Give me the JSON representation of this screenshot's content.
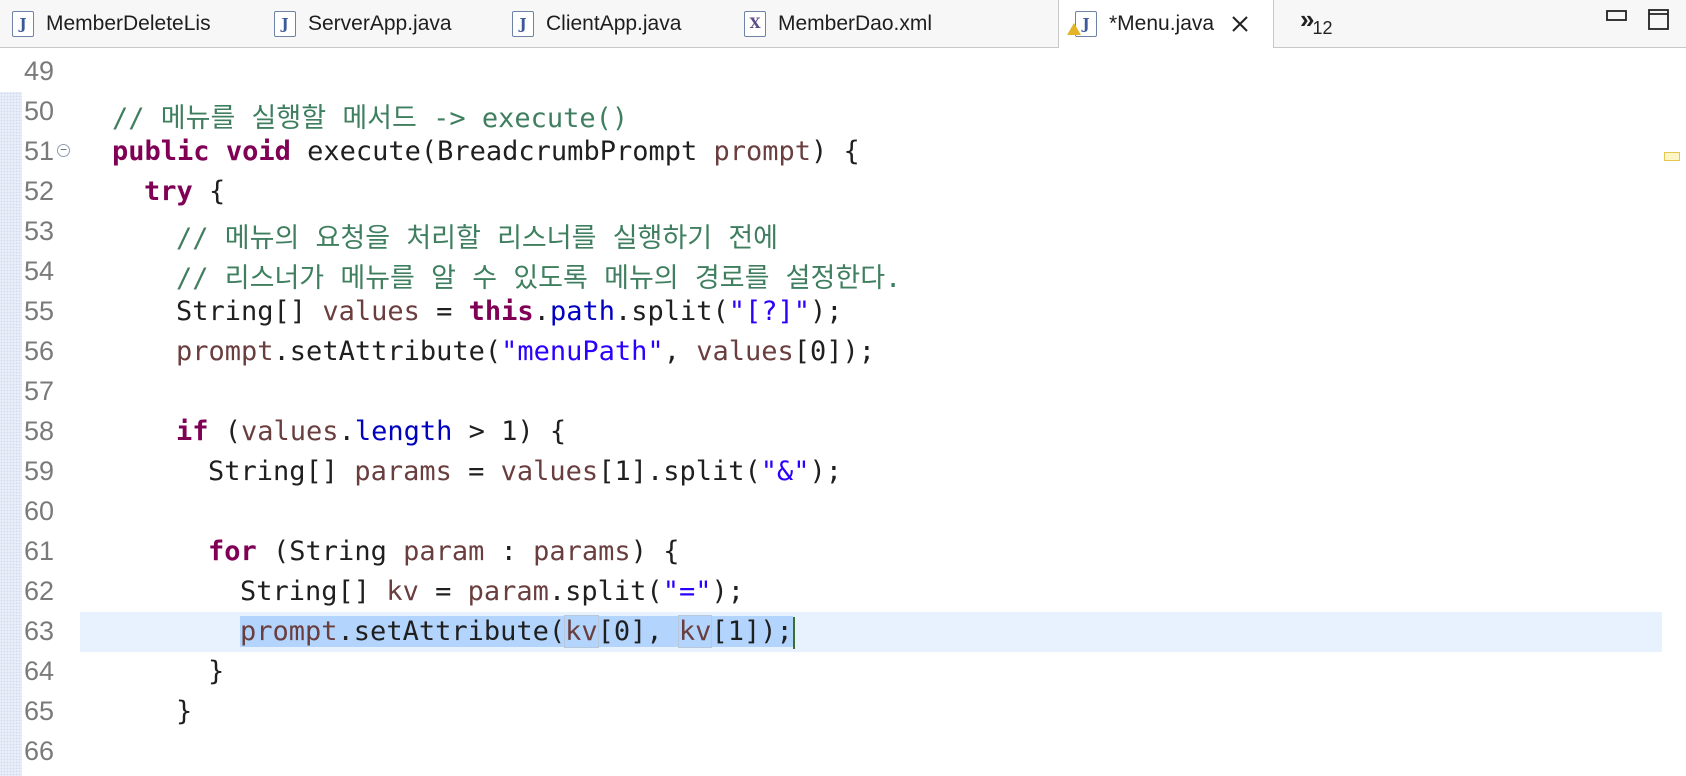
{
  "tabs": [
    {
      "label": "MemberDeleteLis",
      "icon": "java-file-icon",
      "icon_glyph": "J"
    },
    {
      "label": "ServerApp.java",
      "icon": "java-file-icon",
      "icon_glyph": "J"
    },
    {
      "label": "ClientApp.java",
      "icon": "java-file-icon",
      "icon_glyph": "J"
    },
    {
      "label": "MemberDao.xml",
      "icon": "xml-file-icon",
      "icon_glyph": "X"
    },
    {
      "label": "*Menu.java",
      "icon": "java-file-icon-warning",
      "icon_glyph": "J",
      "active": true
    }
  ],
  "overflow": {
    "chevron": "»",
    "count": "12"
  },
  "editor": {
    "lines": {
      "l49": "49",
      "l50": "50",
      "l51": "51",
      "l52": "52",
      "l53": "53",
      "l54": "54",
      "l55": "55",
      "l56": "56",
      "l57": "57",
      "l58": "58",
      "l59": "59",
      "l60": "60",
      "l61": "61",
      "l62": "62",
      "l63": "63",
      "l64": "64",
      "l65": "65",
      "l66": "66"
    },
    "code": {
      "c50_comment": "// 메뉴를 실행할 메서드 -> execute()",
      "c51_public": "public",
      "c51_void": "void",
      "c51_sig": " execute(BreadcrumbPrompt ",
      "c51_prompt": "prompt",
      "c51_end": ") {",
      "c52_try": "try",
      "c52_end": " {",
      "c53": "// 메뉴의 요청을 처리할 리스너를 실행하기 전에",
      "c54": "// 리스너가 메뉴를 알 수 있도록 메뉴의 경로를 설정한다.",
      "c55_a": "String[] ",
      "c55_values": "values",
      "c55_b": " = ",
      "c55_this": "this",
      "c55_c": ".",
      "c55_path": "path",
      "c55_d": ".split(",
      "c55_str": "\"[?]\"",
      "c55_e": ");",
      "c56_prompt": "prompt",
      "c56_a": ".setAttribute(",
      "c56_str": "\"menuPath\"",
      "c56_b": ", ",
      "c56_values": "values",
      "c56_c": "[0]);",
      "c58_if": "if",
      "c58_a": " (",
      "c58_values": "values",
      "c58_b": ".",
      "c58_length": "length",
      "c58_c": " > 1) {",
      "c59_a": "String[] ",
      "c59_params": "params",
      "c59_b": " = ",
      "c59_values": "values",
      "c59_c": "[1].split(",
      "c59_str": "\"&\"",
      "c59_d": ");",
      "c61_for": "for",
      "c61_a": " (String ",
      "c61_param": "param",
      "c61_b": " : ",
      "c61_params": "params",
      "c61_c": ") {",
      "c62_a": "String[] ",
      "c62_kv": "kv",
      "c62_b": " = ",
      "c62_param": "param",
      "c62_c": ".split(",
      "c62_str": "\"=\"",
      "c62_d": ");",
      "c63_prompt": "prompt",
      "c63_a": ".setAttribute(",
      "c63_kv1": "kv",
      "c63_b": "[0], ",
      "c63_kv2": "kv",
      "c63_c": "[1]);",
      "c64": "}",
      "c65": "}"
    }
  },
  "colors": {
    "keyword": "#7f0055",
    "comment": "#3f7f5f",
    "string": "#2a00ff",
    "field": "#0000c0",
    "local_variable": "#6a3e3e",
    "current_line": "#e8f2fe",
    "selection": "#b3d4fc"
  }
}
